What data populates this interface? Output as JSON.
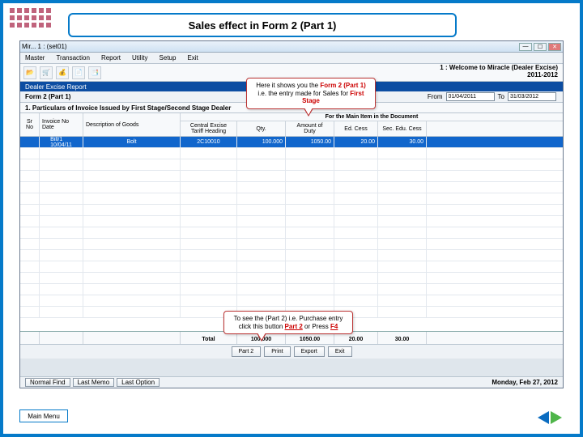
{
  "slide": {
    "title": "Sales effect in Form 2 (Part 1)",
    "main_menu": "Main Menu"
  },
  "app": {
    "title": "Mir... 1 : (set01)",
    "menus": [
      "Master",
      "Transaction",
      "Report",
      "Utility",
      "Setup",
      "Exit"
    ],
    "welcome_line1": "1 : Welcome to Miracle (Dealer Excise)",
    "welcome_line2": "2011-2012",
    "crumb": "Dealer Excise Report",
    "subheader": "Form 2 (Part 1)",
    "from_label": "From",
    "from_value": "01/04/2011",
    "to_label": "To",
    "to_value": "31/03/2012",
    "section": "1.   Particulars of Invoice Issued by First Stage/Second Stage Dealer",
    "super_header": "For the Main Item in the Document",
    "cols": {
      "srno": "Sr No",
      "inv": "Invoice No\nDate",
      "desc": "Description of Goods",
      "tariff": "Central Excise\nTariff Heading",
      "qty": "Qty.",
      "duty": "Amount of\nDuty",
      "edc": "Ed. Cess",
      "sec": "Sec. Edu. Cess"
    },
    "rows": [
      {
        "inv": "Bill/1\n10/04/11",
        "desc": "Bolt",
        "tariff": "2C10010",
        "qty": "100.000",
        "duty": "1050.00",
        "edc": "20.00",
        "sec": "30.00"
      }
    ],
    "total_label": "Total",
    "totals": {
      "qty": "100.000",
      "duty": "1050.00",
      "edc": "20.00",
      "sec": "30.00"
    },
    "buttons": [
      "Part 2",
      "Print",
      "Export",
      "Exit"
    ],
    "status_buttons": [
      "Normal Find",
      "Last Memo",
      "Last Option"
    ],
    "status_date": "Monday, Feb 27, 2012"
  },
  "callout1": {
    "pre": "Here it shows you the ",
    "accent1": "Form 2 (Part 1)",
    "mid": " i.e. the entry made for Sales for ",
    "accent2": "First Stage"
  },
  "callout2": {
    "pre": "To see the (Part 2) i.e. Purchase entry click this button ",
    "btn": "Part 2",
    "mid": " or Press ",
    "key": "F4"
  }
}
